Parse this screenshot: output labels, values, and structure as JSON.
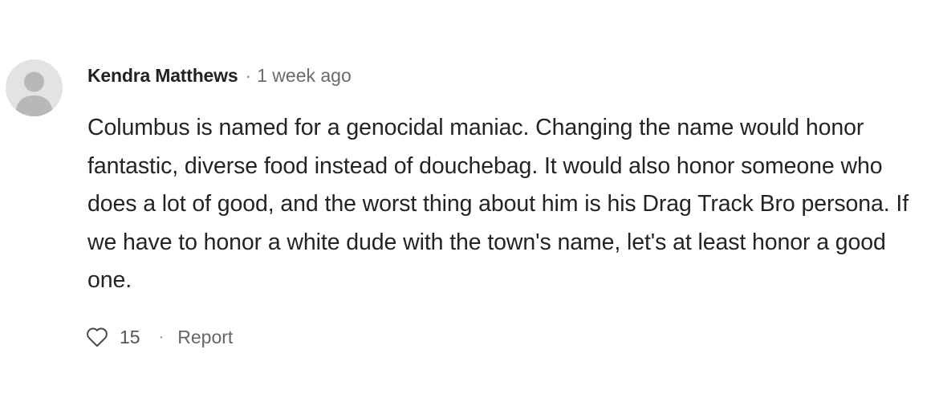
{
  "comment": {
    "author": "Kendra Matthews",
    "separator": "·",
    "timestamp": "1 week ago",
    "avatar_icon": "default-user-avatar-icon",
    "text": "Columbus is named for a genocidal maniac. Changing the name would honor fantastic, diverse food instead of douchebag. It would also honor someone who does a lot of good, and the worst thing about him is his Drag Track Bro persona. If we have to honor a white dude with the town's name, let's at least honor a good one.",
    "like_icon": "heart-outline-icon",
    "like_count": "15",
    "action_separator": "·",
    "report_label": "Report"
  },
  "colors": {
    "avatar_bg": "#e3e3e3",
    "avatar_figure": "#b8b8b8",
    "text_primary": "#242424",
    "text_muted": "#6b6b6b"
  }
}
